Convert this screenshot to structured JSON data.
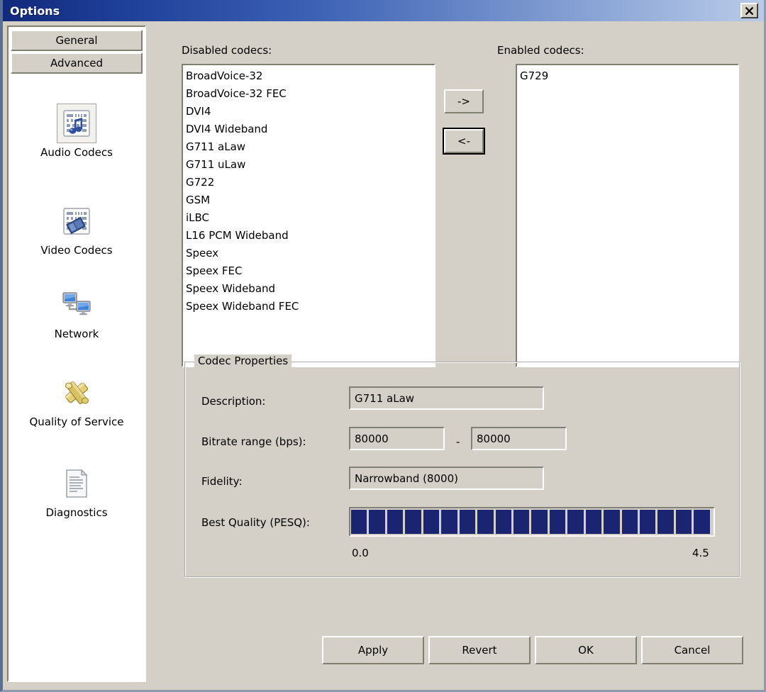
{
  "window": {
    "title": "Options",
    "close_label": "✕",
    "titlebar_gradient_start": "#12297a",
    "titlebar_gradient_end": "#b9cbe8",
    "face_color": "#d4d0c8"
  },
  "sidebar": {
    "tabs": [
      {
        "label": "General",
        "selected": false
      },
      {
        "label": "Advanced",
        "selected": true
      }
    ],
    "items": [
      {
        "label": "Audio Codecs",
        "icon": "audio-codecs-icon",
        "selected": true
      },
      {
        "label": "Video Codecs",
        "icon": "video-codecs-icon",
        "selected": false
      },
      {
        "label": "Network",
        "icon": "network-icon",
        "selected": false
      },
      {
        "label": "Quality of Service",
        "icon": "quality-of-service-icon",
        "selected": false
      },
      {
        "label": "Diagnostics",
        "icon": "diagnostics-icon",
        "selected": false
      }
    ]
  },
  "main": {
    "disabled_label": "Disabled codecs:",
    "enabled_label": "Enabled codecs:",
    "disabled_codecs": [
      "BroadVoice-32",
      "BroadVoice-32 FEC",
      "DVI4",
      "DVI4 Wideband",
      "G711 aLaw",
      "G711 uLaw",
      "G722",
      "GSM",
      "iLBC",
      "L16 PCM Wideband",
      "Speex",
      "Speex FEC",
      "Speex Wideband",
      "Speex Wideband FEC"
    ],
    "enabled_codecs": [
      "G729"
    ],
    "move_right_label": "->",
    "move_left_label": "<-"
  },
  "codec_properties": {
    "legend": "Codec Properties",
    "description_label": "Description:",
    "description_value": "G711 aLaw",
    "bitrate_label": "Bitrate range (bps):",
    "bitrate_min": "80000",
    "bitrate_separator": "-",
    "bitrate_max": "80000",
    "fidelity_label": "Fidelity:",
    "fidelity_value": "Narrowband (8000)",
    "pesq_label": "Best Quality (PESQ):",
    "pesq_scale_min": "0.0",
    "pesq_scale_max": "4.5",
    "pesq_segments": 20,
    "pesq_filled": 20,
    "pesq_color": "#1b2470"
  },
  "footer": {
    "buttons": [
      {
        "label": "Apply"
      },
      {
        "label": "Revert"
      },
      {
        "label": "OK"
      },
      {
        "label": "Cancel"
      }
    ]
  }
}
